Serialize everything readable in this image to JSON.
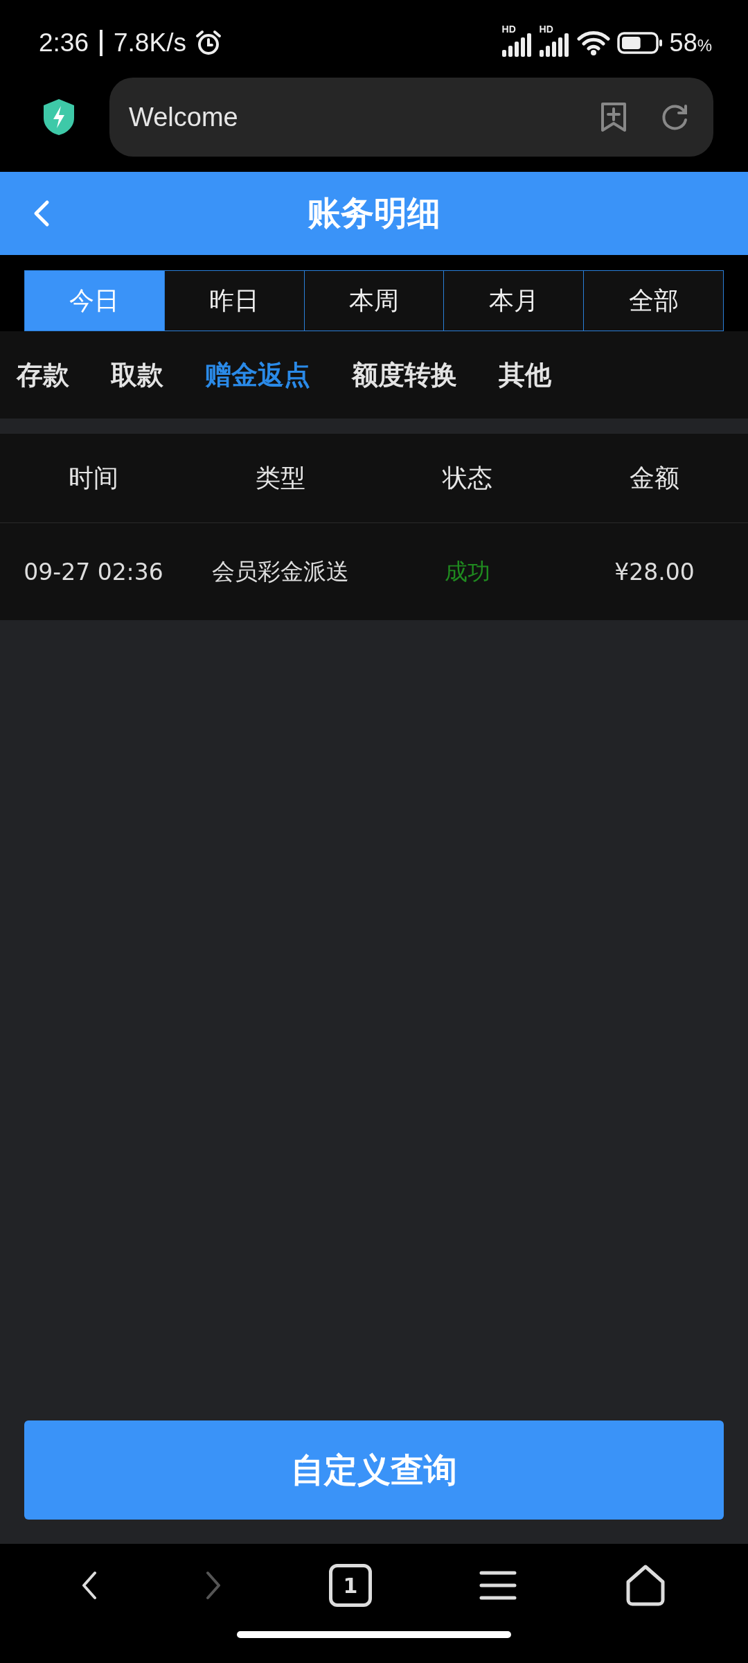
{
  "status_bar": {
    "time": "2:36",
    "speed": "7.8K/s",
    "battery": "58",
    "battery_unit": "%",
    "network_labels": [
      "HD",
      "HD"
    ]
  },
  "browser": {
    "url_text": "Welcome",
    "tab_count": "1"
  },
  "header": {
    "title": "账务明细"
  },
  "periods": [
    {
      "label": "今日",
      "selected": true
    },
    {
      "label": "昨日",
      "selected": false
    },
    {
      "label": "本周",
      "selected": false
    },
    {
      "label": "本月",
      "selected": false
    },
    {
      "label": "全部",
      "selected": false
    }
  ],
  "categories": [
    {
      "label": "存款",
      "selected": false
    },
    {
      "label": "取款",
      "selected": false
    },
    {
      "label": "赠金返点",
      "selected": true
    },
    {
      "label": "额度转换",
      "selected": false
    },
    {
      "label": "其他",
      "selected": false
    }
  ],
  "table": {
    "columns": [
      "时间",
      "类型",
      "状态",
      "金额"
    ],
    "rows": [
      {
        "time": "09-27 02:36",
        "type": "会员彩金派送",
        "status": {
          "text": "成功",
          "kind": "success"
        },
        "amount": "¥28.00"
      }
    ]
  },
  "query_button": "自定义查询",
  "nav": {
    "forward_disabled": true
  }
}
